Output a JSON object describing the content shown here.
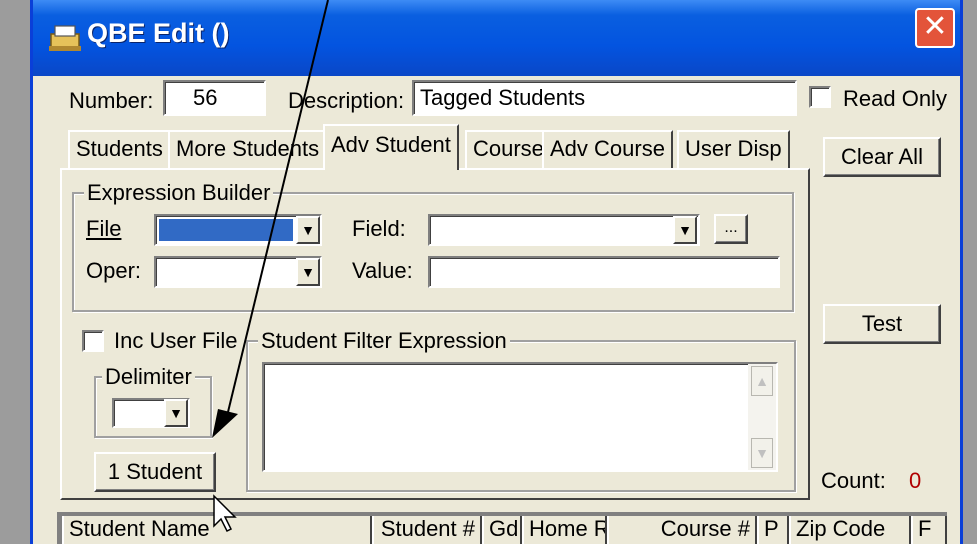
{
  "window": {
    "title": "QBE Edit  ()",
    "close_glyph": "✕"
  },
  "form": {
    "number_label": "Number:",
    "number_value": "56",
    "description_label": "Description:",
    "description_value": "Tagged Students",
    "read_only_label": "Read Only",
    "clear_all_label": "Clear All",
    "test_label": "Test",
    "count_label": "Count:",
    "count_value": "0"
  },
  "tabs": [
    {
      "label": "Students"
    },
    {
      "label": "More Students"
    },
    {
      "label": "Adv Student"
    },
    {
      "label": "Course"
    },
    {
      "label": "Adv Course"
    },
    {
      "label": "User Disp"
    }
  ],
  "expression_builder": {
    "caption": "Expression Builder",
    "file_label": "File",
    "field_label": "Field:",
    "oper_label": "Oper:",
    "value_label": "Value:",
    "browse_label": "..."
  },
  "inc_user_file_label": "Inc User File",
  "delimiter_caption": "Delimiter",
  "one_student_label": "1 Student",
  "filter_caption": "Student Filter Expression",
  "grid_columns": [
    {
      "label": "Student Name"
    },
    {
      "label": "Student #"
    },
    {
      "label": "Gd"
    },
    {
      "label": "Home R"
    },
    {
      "label": "Course #"
    },
    {
      "label": "P"
    },
    {
      "label": "Zip Code"
    },
    {
      "label": "F"
    }
  ],
  "colors": {
    "title_bar": "#0354e0",
    "close_button": "#e3543a",
    "file_combo_selection": "#316ac5",
    "count_value": "#b00000",
    "dialog_face": "#ece9d8"
  }
}
